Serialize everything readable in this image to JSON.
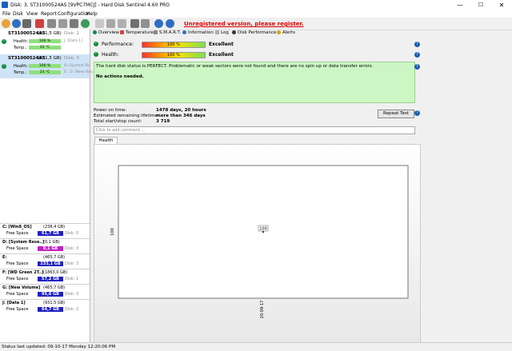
{
  "window": {
    "title": "Disk: 3, ST31000524AS [9VPC7MCJ]  -  Hard Disk Sentinel 4.60 PRO",
    "minimize": "—",
    "maximize": "☐",
    "close": "✕"
  },
  "menu": [
    "File",
    "Disk",
    "View",
    "Report",
    "Configuration",
    "Help"
  ],
  "toolbar": {
    "unregistered_link": "Unregistered version, please register."
  },
  "disks": [
    {
      "name": "ST31000524AS",
      "size": "(931,5 GB)",
      "num": "Disk: 2",
      "health_label": "Health:",
      "health": "100 %",
      "health_value": 100,
      "temp_label": "Temp.:",
      "temp": "35 °C",
      "drive": "J: [Data 1]"
    },
    {
      "name": "ST31000524AS",
      "size": "(931,5 GB)",
      "num": "Disk: 3",
      "health_label": "Health:",
      "health": "100 %",
      "health_value": 100,
      "temp_label": "Temp.:",
      "temp": "23 °C",
      "drive": "D: [System Re",
      "drive2": "E:, G: [New Volu"
    }
  ],
  "volumes": [
    {
      "name": "C: [Win8_OS]",
      "size": "(238,4 GB)",
      "free_label": "Free Space",
      "free": "61,7 GB",
      "disk": "Disk: 0",
      "color": "#2020c0"
    },
    {
      "name": "D: [System Rese..]",
      "size": "(0,1 GB)",
      "free_label": "Free Space",
      "free": "0,1 GB",
      "disk": "Disk: 3",
      "color": "#c020c0"
    },
    {
      "name": "E:",
      "size": "(465,7 GB)",
      "free_label": "Free Space",
      "free": "233,1 GB",
      "disk": "Disk: 3",
      "color": "#2020c0"
    },
    {
      "name": "F: [WD Green 2T..]",
      "size": "(1863,0 GB)",
      "free_label": "Free Space",
      "free": "57,2 GB",
      "disk": "Disk: 1",
      "color": "#2020c0"
    },
    {
      "name": "G: [New Volume]",
      "size": "(465,7 GB)",
      "free_label": "Free Space",
      "free": "95,6 GB",
      "disk": "Disk: 3",
      "color": "#2020c0"
    },
    {
      "name": "J: [Data 1]",
      "size": "(931,5 GB)",
      "free_label": "Free Space",
      "free": "64,7 GB",
      "disk": "Disk: 2",
      "color": "#2020c0"
    }
  ],
  "tabs": [
    "Overview",
    "Temperature",
    "S.M.A.R.T.",
    "Information",
    "Log",
    "Disk Performance",
    "Alerts"
  ],
  "overview": {
    "performance_label": "Performance:",
    "performance": "100 %",
    "performance_value": 100,
    "performance_status": "Excellent",
    "health_label": "Health:",
    "health": "100 %",
    "health_value": 100,
    "health_status": "Excellent",
    "status_text": "The hard disk status is PERFECT. Problematic or weak sectors were not found and there are no spin up or data transfer errors.",
    "actions_text": "No actions needed.",
    "power_on_label": "Power on time:",
    "power_on": "1478 days, 20 hours",
    "remaining_label": "Estimated remaining lifetime:",
    "remaining": "more than 346 days",
    "startstop_label": "Total start/stop count:",
    "startstop": "3 719",
    "repeat_button": "Repeat Test",
    "comment_placeholder": "Click to add comment ..."
  },
  "health_tab": "Health (%)",
  "chart_data": {
    "type": "line",
    "title": "",
    "xlabel": "",
    "ylabel": "",
    "y_ticks": [
      "100"
    ],
    "x_ticks": [
      "20-09-17"
    ],
    "series": [
      {
        "values": [
          100
        ]
      }
    ],
    "x": [
      "20-09-17"
    ],
    "data_labels": [
      "100"
    ],
    "ylim": [
      99,
      101
    ]
  },
  "statusbar": "Status last updated: 09-10-17 Monday 12:20:06 PM"
}
